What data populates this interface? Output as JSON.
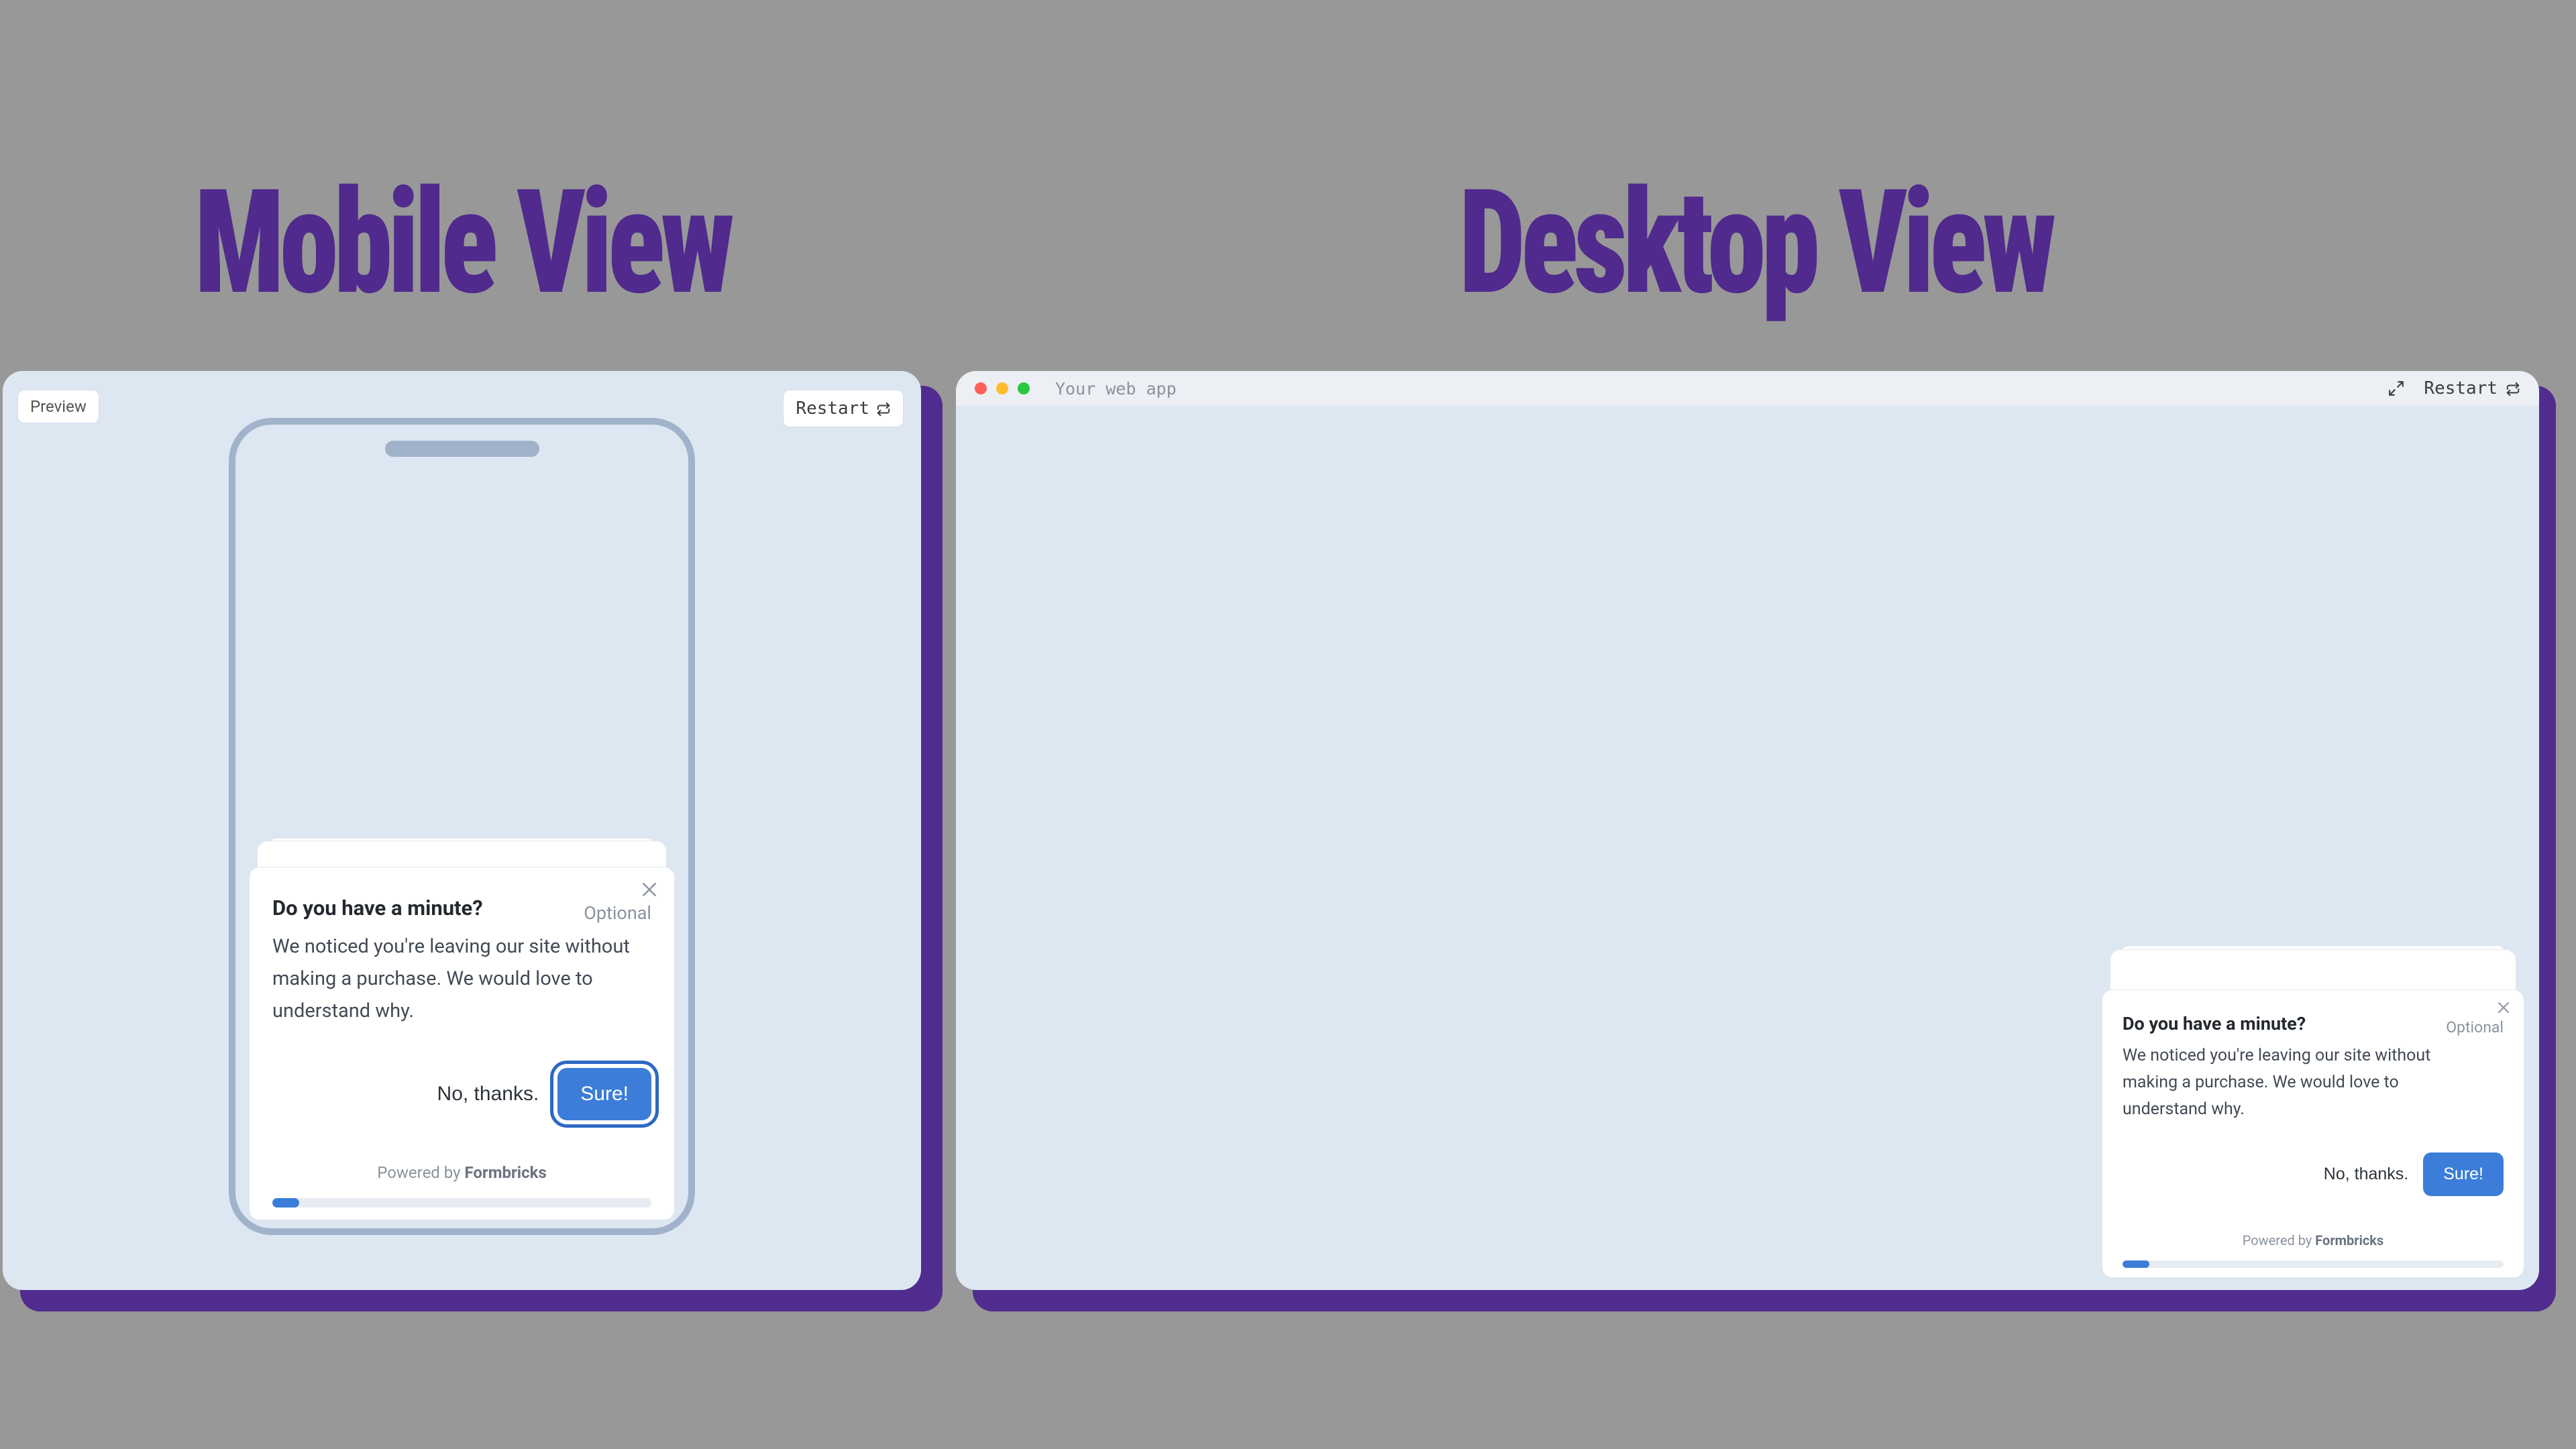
{
  "headings": {
    "mobile": "Mobile View",
    "desktop": "Desktop View"
  },
  "mobile_panel": {
    "preview_label": "Preview",
    "restart_label": "Restart"
  },
  "desktop_panel": {
    "topbar_title": "Your web app",
    "restart_label": "Restart"
  },
  "survey": {
    "title": "Do you have a minute?",
    "optional": "Optional",
    "body": "We noticed you're leaving our site without making a purchase. We would love to understand why.",
    "secondary": "No, thanks.",
    "primary": "Sure!",
    "powered_prefix": "Powered by ",
    "powered_brand": "Formbricks"
  }
}
